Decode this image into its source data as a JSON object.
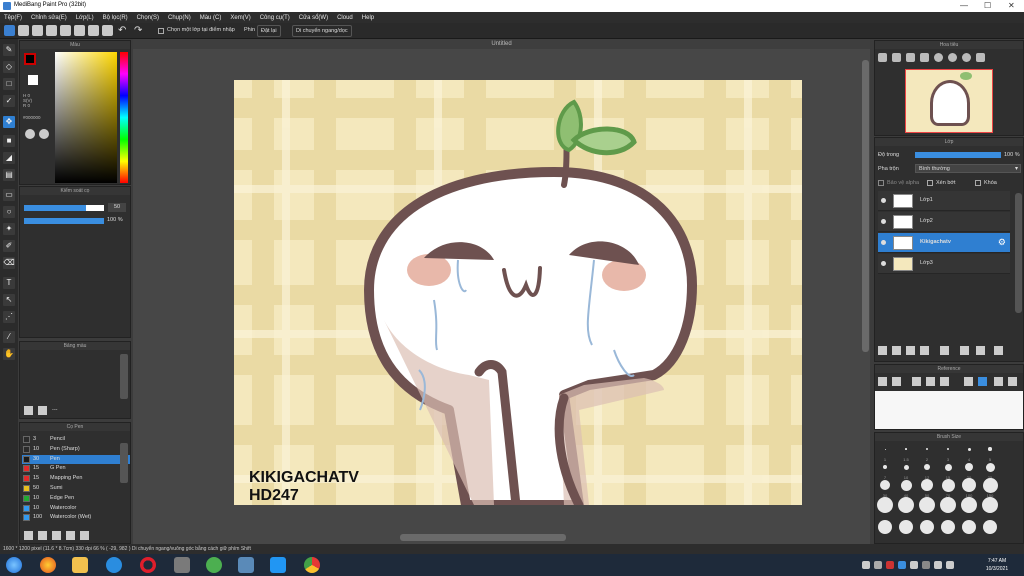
{
  "window": {
    "title": "MediBang Paint Pro (32bit)"
  },
  "menu": [
    "Tệp(F)",
    "Chỉnh sửa(E)",
    "Lớp(L)",
    "Bộ lọc(R)",
    "Chọn(S)",
    "Chụp(N)",
    "Màu (C)",
    "Xem(V)",
    "Công cụ(T)",
    "Cửa sổ(W)",
    "Cloud",
    "Help"
  ],
  "toolbar": {
    "select_one_layer": "Chọn một lớp tại điểm nhập",
    "fill_label": "Phin",
    "fill_value": "Đặt lại",
    "move_label": "Di chuyển ngang/dọc"
  },
  "color_panel": {
    "title": "Màu",
    "hsv": "H 0\nS(V)\nR 0",
    "hex": "#000000"
  },
  "brush_control": {
    "title": "Kiểm soát cọ",
    "size": "50",
    "opacity": "100 %"
  },
  "palette": {
    "title": "Bảng màu",
    "extra": "---"
  },
  "brushes": {
    "title": "Cọ Pen",
    "items": [
      {
        "size": "3",
        "name": "Pencil",
        "color": "#2b2b2b"
      },
      {
        "size": "10",
        "name": "Pen (Sharp)",
        "color": "#2b2b2b"
      },
      {
        "size": "30",
        "name": "Pen",
        "color": "#1a1a1a",
        "selected": true
      },
      {
        "size": "15",
        "name": "G Pen",
        "color": "#e22b2b"
      },
      {
        "size": "15",
        "name": "Mapping Pen",
        "color": "#e22b2b"
      },
      {
        "size": "50",
        "name": "Sumi",
        "color": "#e8c020"
      },
      {
        "size": "10",
        "name": "Edge Pen",
        "color": "#22aa33"
      },
      {
        "size": "10",
        "name": "Watercolor",
        "color": "#3399ee"
      },
      {
        "size": "100",
        "name": "Watercolor (Wet)",
        "color": "#3399ee"
      }
    ]
  },
  "canvas": {
    "title": "Untitled",
    "watermark_line1": "KIKIGACHATV",
    "watermark_line2": "HD247"
  },
  "navigator": {
    "title": "Hoa tiêu"
  },
  "layers_panel": {
    "title": "Lớp",
    "opacity_label": "Độ trong",
    "opacity_value": "100 %",
    "blend_label": "Pha trộn",
    "blend_value": "Bình thường",
    "protect_alpha": "Bảo vệ alpha",
    "clipping": "Xén bớt",
    "lock": "Khóa",
    "layers": [
      {
        "name": "Lớp1",
        "selected": false
      },
      {
        "name": "Lớp2",
        "selected": false
      },
      {
        "name": "Kikigachatv",
        "selected": true
      },
      {
        "name": "Lớp3",
        "selected": false
      }
    ]
  },
  "reference": {
    "title": "Reference"
  },
  "brush_size": {
    "title": "Brush Size",
    "labels": [
      "1",
      "1.5",
      "2",
      "3",
      "4",
      "5",
      "7",
      "10",
      "12",
      "15",
      "20",
      "25",
      "30",
      "40",
      "50",
      "70",
      "100",
      "150"
    ]
  },
  "status": {
    "text": "1600 * 1200 pixel  (11.6 * 8.7cm)  330 dpi  66 %  ( -29, 982 )  Di chuyển ngang/vuông góc bằng cách giữ phím Shift"
  },
  "clock": {
    "time": "7:47 AM",
    "date": "10/3/2021"
  },
  "colors": {
    "accent": "#2f7fd1",
    "canvas_bg": "#f3e6b8",
    "plaid": "#e6d296",
    "outline": "#6e5150"
  }
}
